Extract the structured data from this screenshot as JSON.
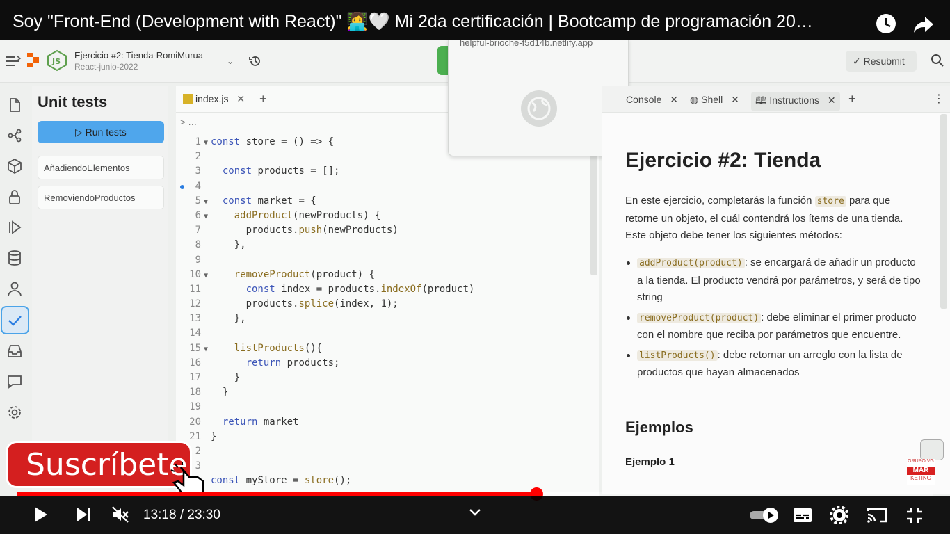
{
  "video": {
    "title": "Soy \"Front-End (Development with React)\" 👩‍💻🤍 Mi 2da certificación | Bootcamp de programación 20…",
    "time_current": "13:18",
    "time_total": "23:30",
    "progress_fraction": 0.567,
    "buffered_fraction": 0.635
  },
  "replit": {
    "project_title": "Ejercicio #2: Tienda-RomiMurua",
    "project_subtitle": "React-junio-2022",
    "resubmit_label": "Resubmit",
    "popup_url": "helpful-brioche-f5d14b.netlify.app"
  },
  "unit_tests": {
    "heading": "Unit tests",
    "run_label": "Run tests",
    "tests": [
      "AñadiendoElementos",
      "RemoviendoProductos"
    ]
  },
  "editor": {
    "tab_label": "index.js",
    "breadcrumb": "> …",
    "lines": [
      {
        "n": "1",
        "fold": true,
        "text": "const store = () => {"
      },
      {
        "n": "2",
        "fold": false,
        "text": ""
      },
      {
        "n": "3",
        "fold": false,
        "text": "  const products = [];"
      },
      {
        "n": "4",
        "fold": false,
        "text": ""
      },
      {
        "n": "5",
        "fold": true,
        "text": "  const market = {"
      },
      {
        "n": "6",
        "fold": true,
        "text": "    addProduct(newProducts) {"
      },
      {
        "n": "7",
        "fold": false,
        "text": "      products.push(newProducts)"
      },
      {
        "n": "8",
        "fold": false,
        "text": "    },"
      },
      {
        "n": "9",
        "fold": false,
        "text": ""
      },
      {
        "n": "10",
        "fold": true,
        "text": "    removeProduct(product) {"
      },
      {
        "n": "11",
        "fold": false,
        "text": "      const index = products.indexOf(product)"
      },
      {
        "n": "12",
        "fold": false,
        "text": "      products.splice(index, 1);"
      },
      {
        "n": "13",
        "fold": false,
        "text": "    },"
      },
      {
        "n": "14",
        "fold": false,
        "text": ""
      },
      {
        "n": "15",
        "fold": true,
        "text": "    listProducts(){"
      },
      {
        "n": "16",
        "fold": false,
        "text": "      return products;"
      },
      {
        "n": "17",
        "fold": false,
        "text": "    }"
      },
      {
        "n": "18",
        "fold": false,
        "text": "  }"
      },
      {
        "n": "19",
        "fold": false,
        "text": ""
      },
      {
        "n": "20",
        "fold": false,
        "text": "  return market"
      },
      {
        "n": "21",
        "fold": false,
        "text": "}"
      },
      {
        "n": "2",
        "fold": false,
        "text": ""
      },
      {
        "n": "3",
        "fold": false,
        "text": ""
      },
      {
        "n": "",
        "fold": false,
        "text": "const myStore = store();"
      }
    ]
  },
  "right_tabs": [
    "Console",
    "Shell",
    "Instructions"
  ],
  "instructions": {
    "title": "Ejercicio #2: Tienda",
    "intro_before": "En este ejercicio, completarás la función ",
    "intro_code": "store",
    "intro_after": " para que retorne un objeto, el cuál contendrá los ítems de una tienda. Este objeto debe tener los siguientes métodos:",
    "items": [
      {
        "code": "addProduct(product)",
        "text": ": se encargará de añadir un producto a la tienda. El producto vendrá por parámetros, y será de tipo string"
      },
      {
        "code": "removeProduct(product)",
        "text": ": debe eliminar el primer producto con el nombre que reciba por parámetros que encuentre."
      },
      {
        "code": "listProducts()",
        "text": ": debe retornar un arreglo con la lista de productos que hayan almacenados"
      }
    ],
    "examples_heading": "Ejemplos",
    "example1": "Ejemplo 1"
  },
  "overlay": {
    "subscribe_label": "Suscríbete",
    "brand_top": "GRUPO VG",
    "brand_mid": "MAR",
    "brand_bottom": "KETING"
  },
  "icons": [
    "clock-icon",
    "share-icon",
    "play-icon",
    "next-icon",
    "mute-icon",
    "settings-icon",
    "cast-icon",
    "fullscreen-exit-icon",
    "subtitles-icon",
    "autoplay-toggle"
  ],
  "colors": {
    "progress": "#ff0000",
    "run_button": "#4fa6ec",
    "active_sidebar": "#4aa3e8"
  }
}
